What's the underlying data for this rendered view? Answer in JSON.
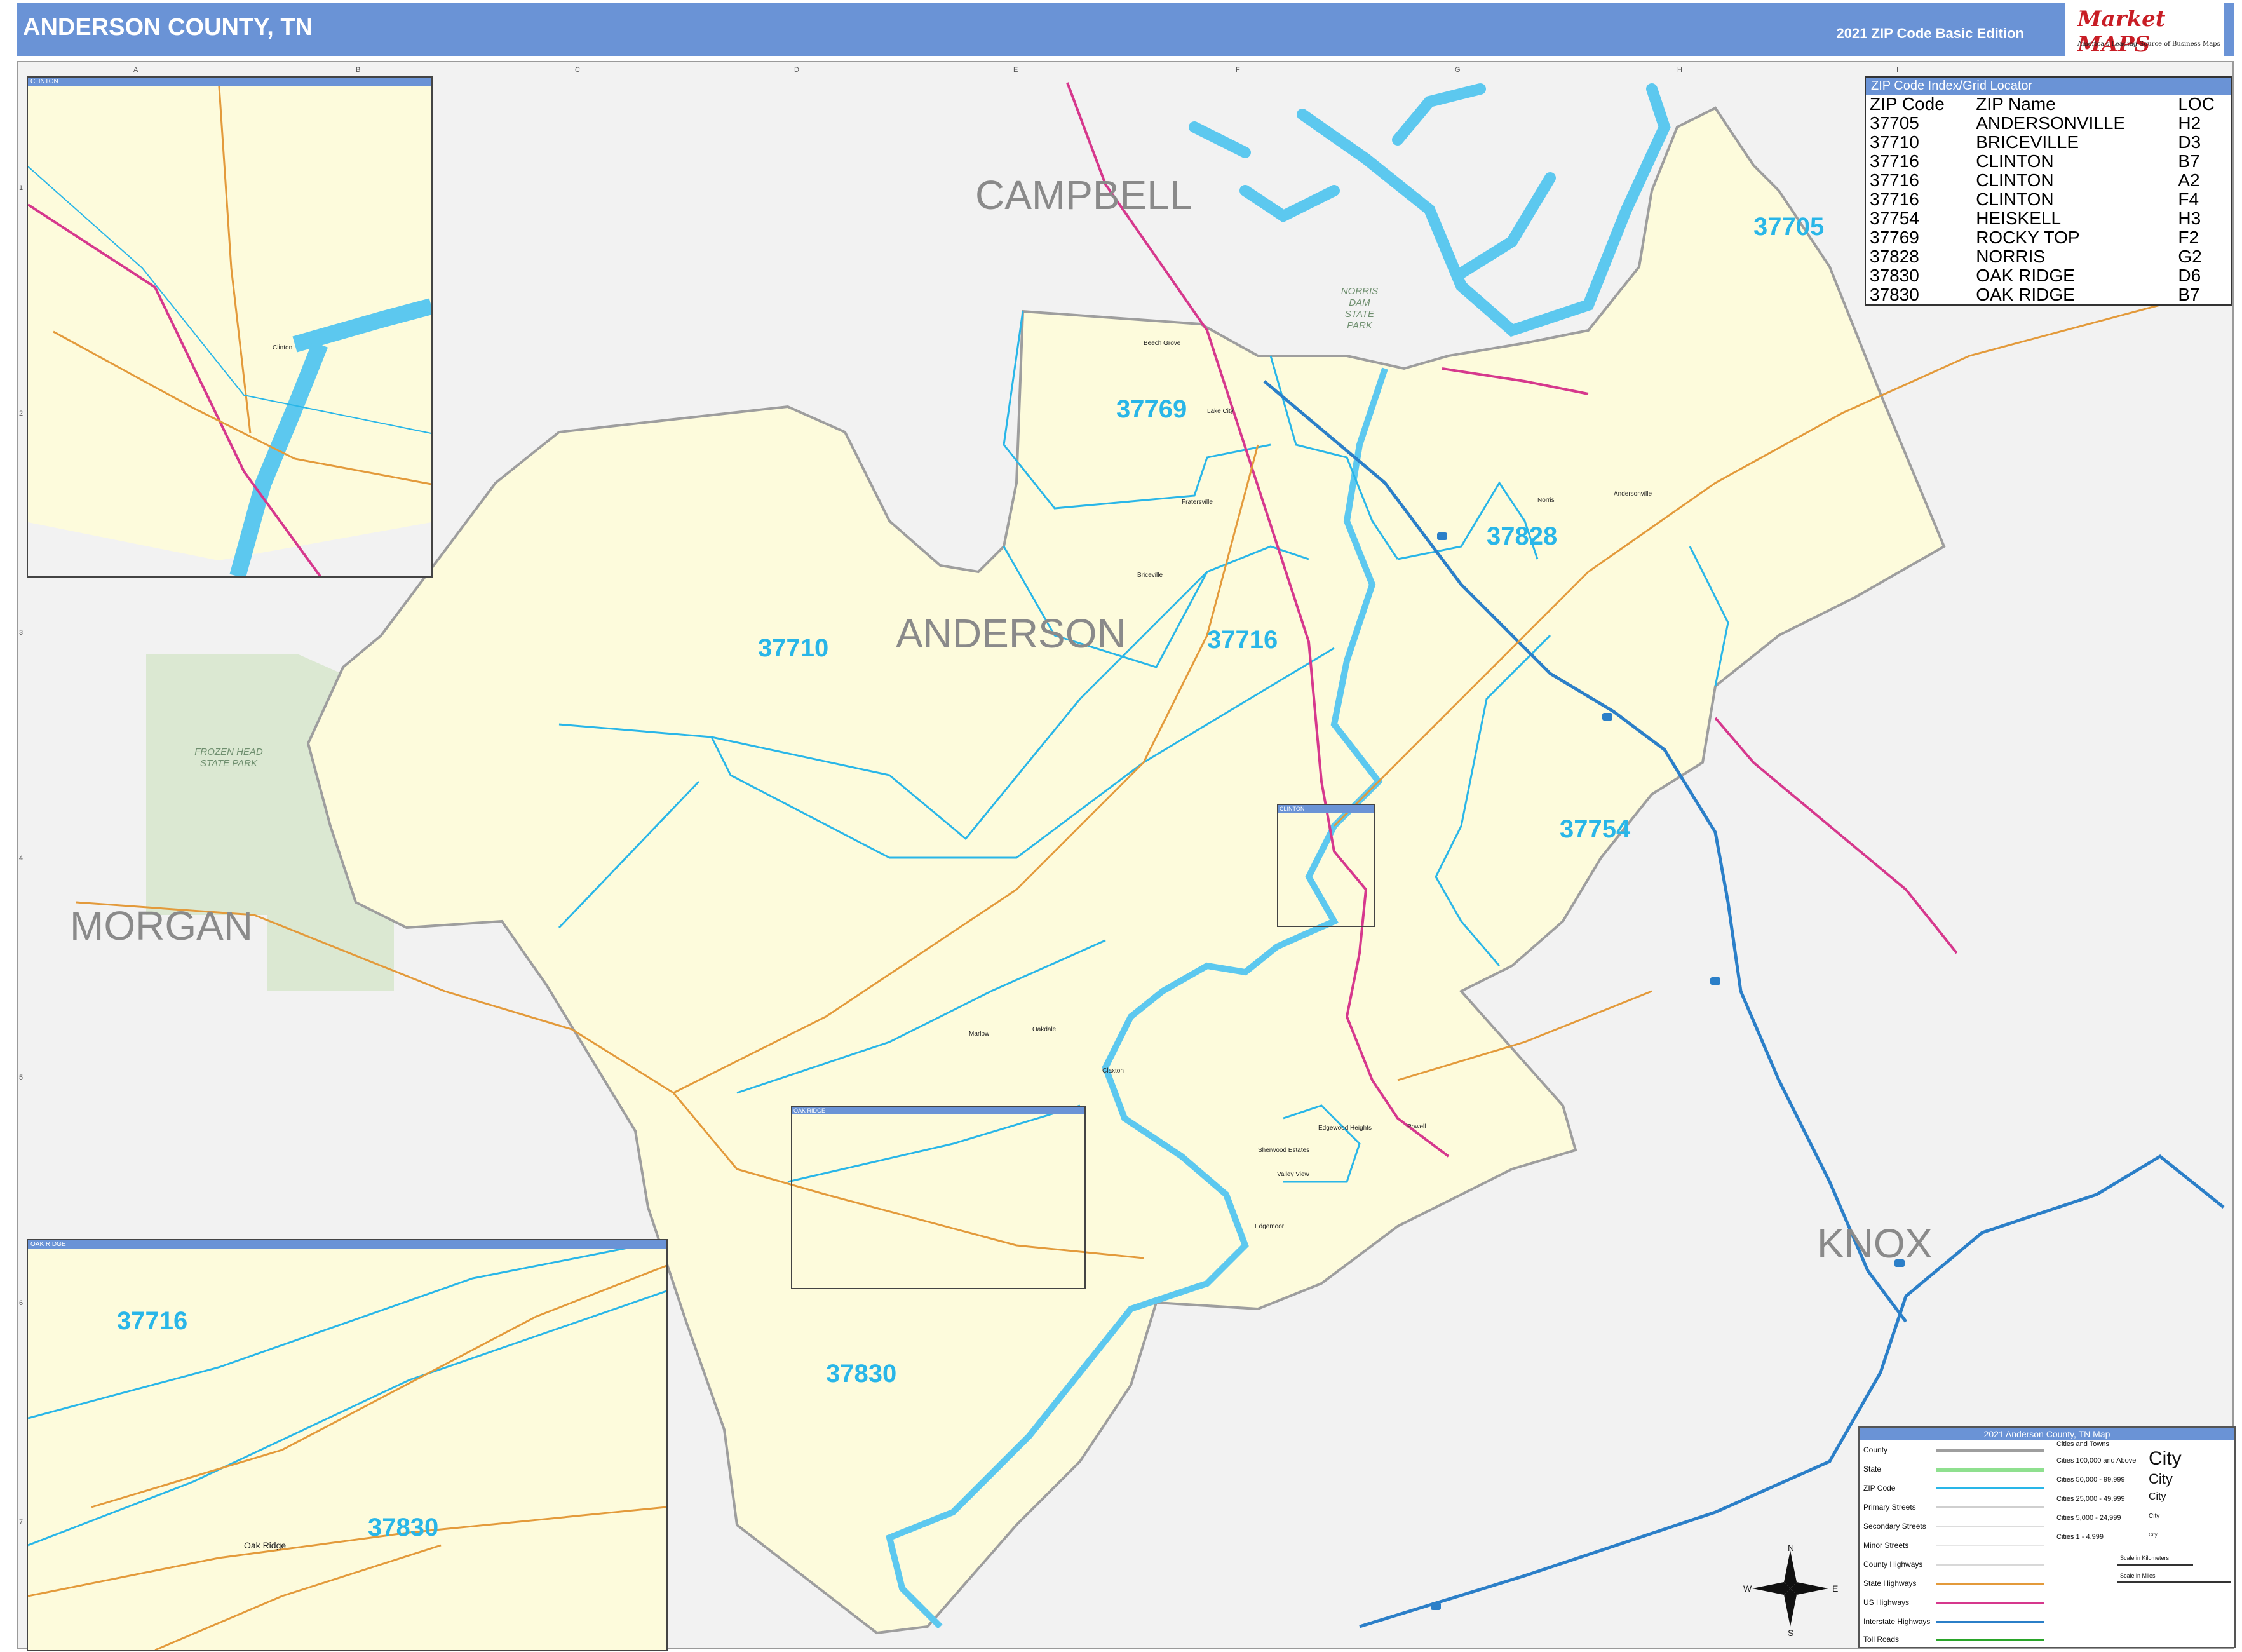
{
  "header": {
    "title": "ANDERSON COUNTY, TN",
    "edition": "2021 ZIP Code Basic Edition",
    "logo_brand": "Market MAPS",
    "logo_tagline": "America's Leading Source of Business Maps"
  },
  "grid": {
    "columns": [
      "A",
      "B",
      "C",
      "D",
      "E",
      "F",
      "G",
      "H",
      "I"
    ],
    "rows": [
      "1",
      "2",
      "3",
      "4",
      "5",
      "6",
      "7"
    ]
  },
  "counties": {
    "campbell": "CAMPBELL",
    "anderson": "ANDERSON",
    "morgan": "MORGAN",
    "knox": "KNOX"
  },
  "zip_labels": {
    "z37705": "37705",
    "z37769": "37769",
    "z37828": "37828",
    "z37710": "37710",
    "z37716": "37716",
    "z37754": "37754",
    "z37830": "37830"
  },
  "parks": {
    "frozen_head": "FROZEN HEAD STATE PARK",
    "norris_dam": "NORRIS DAM STATE PARK"
  },
  "towns": {
    "lake_city": "Lake City",
    "beech_grove": "Beech Grove",
    "fratersville": "Fratersville",
    "briceville": "Briceville",
    "norris": "Norris",
    "andersonville": "Andersonville",
    "clinton": "Clinton",
    "marlow": "Marlow",
    "oliver_springs": "Oakdale",
    "claxton": "Claxton",
    "edgewood": "Edgewood Heights",
    "sherwood": "Sherwood Estates",
    "valley_view": "Valley View",
    "edgemoor": "Edgemoor",
    "powell": "Powell",
    "oak_ridge": "Oak Ridge"
  },
  "zip_index": {
    "title": "ZIP Code Index/Grid Locator",
    "col_zip": "ZIP Code",
    "col_name": "ZIP Name",
    "col_loc": "LOC",
    "rows": [
      {
        "zip": "37705",
        "name": "ANDERSONVILLE",
        "loc": "H2"
      },
      {
        "zip": "37710",
        "name": "BRICEVILLE",
        "loc": "D3"
      },
      {
        "zip": "37716",
        "name": "CLINTON",
        "loc": "B7"
      },
      {
        "zip": "37716",
        "name": "CLINTON",
        "loc": "A2"
      },
      {
        "zip": "37716",
        "name": "CLINTON",
        "loc": "F4"
      },
      {
        "zip": "37754",
        "name": "HEISKELL",
        "loc": "H3"
      },
      {
        "zip": "37769",
        "name": "ROCKY TOP",
        "loc": "F2"
      },
      {
        "zip": "37828",
        "name": "NORRIS",
        "loc": "G2"
      },
      {
        "zip": "37830",
        "name": "OAK RIDGE",
        "loc": "D6"
      },
      {
        "zip": "37830",
        "name": "OAK RIDGE",
        "loc": "B7"
      }
    ]
  },
  "insets": {
    "clinton": {
      "title": "CLINTON",
      "label": "Clinton"
    },
    "oak_ridge": {
      "title": "OAK RIDGE",
      "zip_a": "37716",
      "zip_b": "37830",
      "label": "Oak Ridge"
    },
    "locator_clinton": "CLINTON",
    "locator_oak_ridge": "OAK RIDGE"
  },
  "legend": {
    "title": "2021 Anderson County, TN Map",
    "items": [
      "County",
      "State",
      "ZIP Code",
      "Primary Streets",
      "Secondary Streets",
      "Minor Streets",
      "County Highways",
      "State Highways",
      "US Highways",
      "Interstate Highways",
      "Toll Roads"
    ],
    "cities_title": "Cities and Towns",
    "city_sizes": [
      "Cities 100,000 and Above",
      "Cities 50,000 - 99,999",
      "Cities 25,000 - 49,999",
      "Cities 5,000 - 24,999",
      "Cities 1 - 4,999"
    ],
    "city_sample": "City",
    "scale_km": "Scale in Kilometers",
    "scale_mi": "Scale in Miles"
  },
  "compass": {
    "n": "N",
    "s": "S",
    "e": "E",
    "w": "W"
  },
  "colors": {
    "county_fill": "#fdfbdc",
    "zip_line": "#29b6e8",
    "water": "#5cc8ef",
    "interstate": "#2b7fc8",
    "us_highway": "#d6388d",
    "state_highway": "#e39a3b",
    "park": "#dbe8d2",
    "header": "#6a93d6"
  }
}
